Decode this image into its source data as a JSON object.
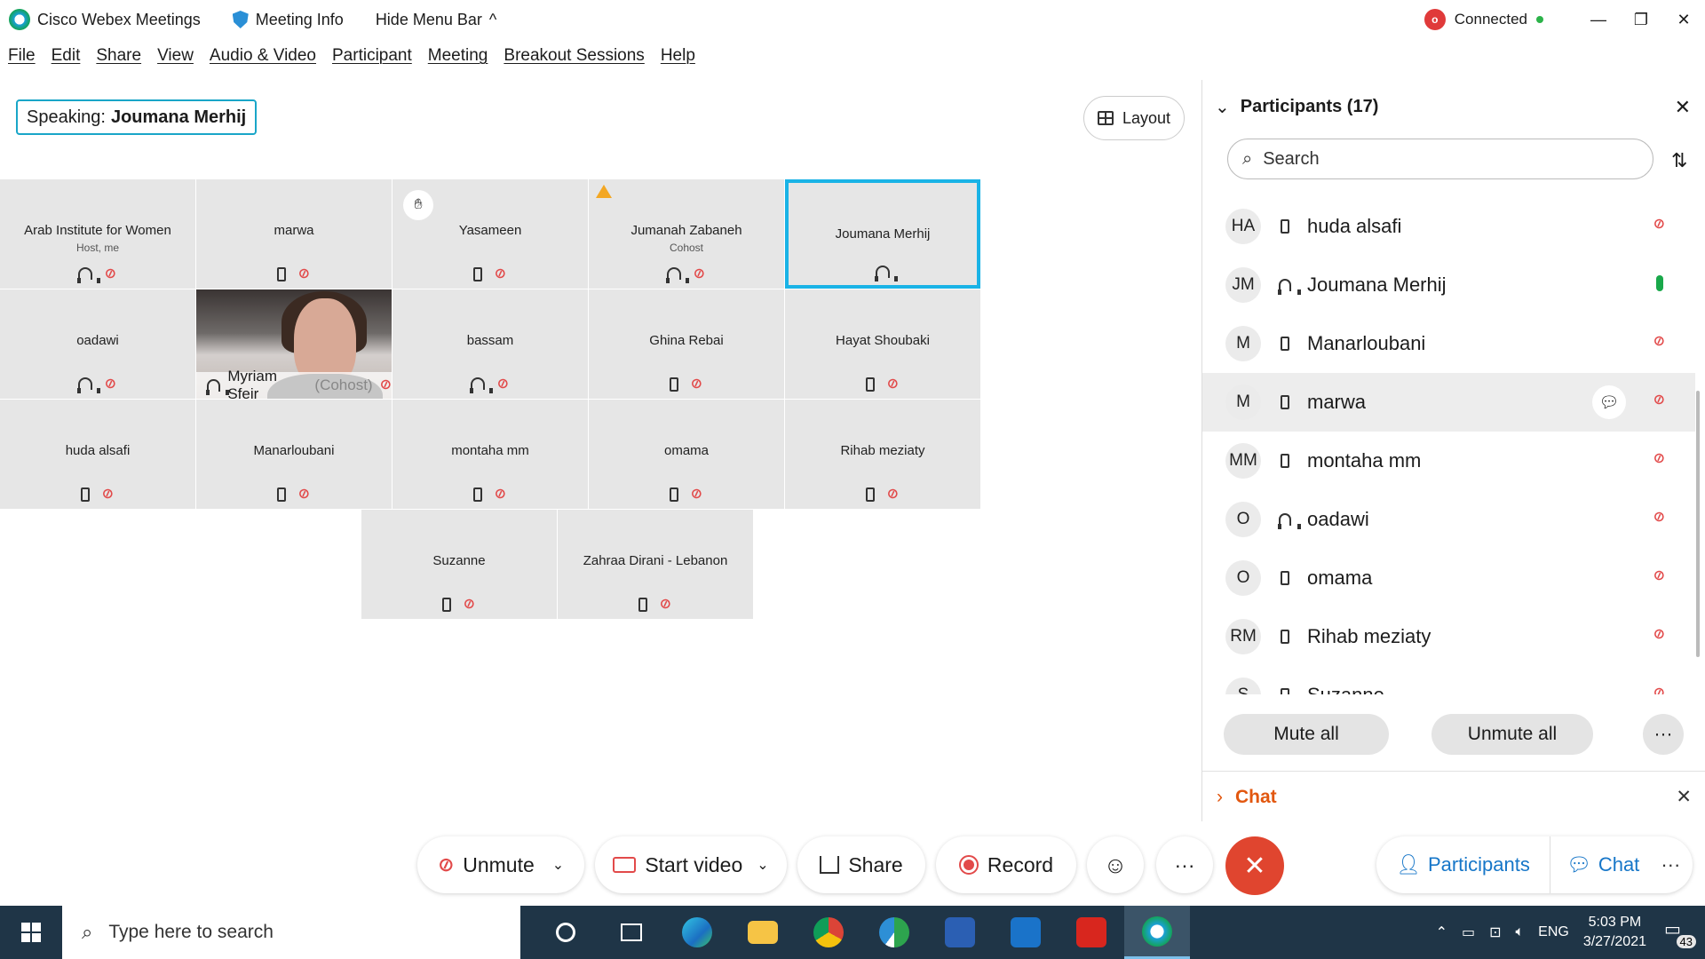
{
  "titlebar": {
    "app_name": "Cisco Webex Meetings",
    "meeting_info": "Meeting Info",
    "hide_menu": "Hide Menu Bar",
    "hide_menu_chevron": "^",
    "rec_letter": "o",
    "status": "Connected",
    "min": "—",
    "restore": "❐",
    "close": "✕"
  },
  "menu": [
    "File",
    "Edit",
    "Share",
    "View",
    "Audio & Video",
    "Participant",
    "Meeting",
    "Breakout Sessions",
    "Help"
  ],
  "stage": {
    "speaking_label": "Speaking:",
    "speaking_name": "Joumana Merhij",
    "layout_label": "Layout"
  },
  "tiles": [
    {
      "name": "Arab Institute for Women",
      "sub": "Host, me",
      "device": "headset",
      "muted": true
    },
    {
      "name": "marwa",
      "sub": "",
      "device": "phone",
      "muted": true
    },
    {
      "name": "Yasameen",
      "sub": "",
      "device": "phone",
      "muted": true,
      "raise": true
    },
    {
      "name": "Jumanah Zabaneh",
      "sub": "Cohost",
      "device": "headset",
      "muted": true,
      "warn": true
    },
    {
      "name": "Joumana Merhij",
      "sub": "",
      "device": "headset",
      "muted": false,
      "active": true
    },
    {
      "name": "oadawi",
      "sub": "",
      "device": "headset",
      "muted": true
    },
    {
      "name": "Myriam Sfeir",
      "sub": "(Cohost)",
      "device": "headset",
      "muted": true,
      "video": true
    },
    {
      "name": "bassam",
      "sub": "",
      "device": "headset",
      "muted": true
    },
    {
      "name": "Ghina Rebai",
      "sub": "",
      "device": "phone",
      "muted": true
    },
    {
      "name": "Hayat Shoubaki",
      "sub": "",
      "device": "phone",
      "muted": true
    },
    {
      "name": "huda alsafi",
      "sub": "",
      "device": "phone",
      "muted": true
    },
    {
      "name": "Manarloubani",
      "sub": "",
      "device": "phone",
      "muted": true
    },
    {
      "name": "montaha mm",
      "sub": "",
      "device": "phone",
      "muted": true
    },
    {
      "name": "omama",
      "sub": "",
      "device": "phone",
      "muted": true
    },
    {
      "name": "Rihab meziaty",
      "sub": "",
      "device": "phone",
      "muted": true
    },
    {
      "name": "Suzanne",
      "sub": "",
      "device": "phone",
      "muted": true
    },
    {
      "name": "Zahraa Dirani - Lebanon",
      "sub": "",
      "device": "phone",
      "muted": true
    }
  ],
  "toolbar": {
    "unmute": "Unmute",
    "start_video": "Start video",
    "share": "Share",
    "record": "Record",
    "more": "···",
    "end": "✕"
  },
  "panel": {
    "title": "Participants (17)",
    "search_placeholder": "Search",
    "mute_all": "Mute all",
    "unmute_all": "Unmute all",
    "more": "···",
    "chat_title": "Chat",
    "participants": [
      {
        "initials": "HA",
        "name": "huda alsafi",
        "device": "phone",
        "mic": "muted"
      },
      {
        "initials": "JM",
        "name": "Joumana Merhij",
        "device": "headset",
        "mic": "on"
      },
      {
        "initials": "M",
        "name": "Manarloubani",
        "device": "phone",
        "mic": "muted"
      },
      {
        "initials": "M",
        "name": "marwa",
        "device": "phone",
        "mic": "muted",
        "highlight": true
      },
      {
        "initials": "MM",
        "name": "montaha mm",
        "device": "phone",
        "mic": "muted"
      },
      {
        "initials": "O",
        "name": "oadawi",
        "device": "headset",
        "mic": "muted"
      },
      {
        "initials": "O",
        "name": "omama",
        "device": "phone",
        "mic": "muted"
      },
      {
        "initials": "RM",
        "name": "Rihab meziaty",
        "device": "phone",
        "mic": "muted"
      },
      {
        "initials": "S",
        "name": "Suzanne",
        "device": "phone",
        "mic": "muted"
      }
    ]
  },
  "right_toolbar": {
    "participants": "Participants",
    "chat": "Chat",
    "more": "···"
  },
  "taskbar": {
    "search_placeholder": "Type here to search",
    "lang": "ENG",
    "time": "5:03 PM",
    "date": "3/27/2021",
    "notifications": "43",
    "apps": [
      "cortana",
      "task-view",
      "edge",
      "file-explorer",
      "chrome",
      "maps",
      "word",
      "outlook",
      "acrobat",
      "webex"
    ]
  },
  "colors": {
    "accent": "#19a6c8",
    "mute_red": "#e24a4a",
    "end_red": "#e0452f",
    "chat_orange": "#e2570f",
    "link_blue": "#1676c8",
    "taskbar": "#1f3547"
  }
}
